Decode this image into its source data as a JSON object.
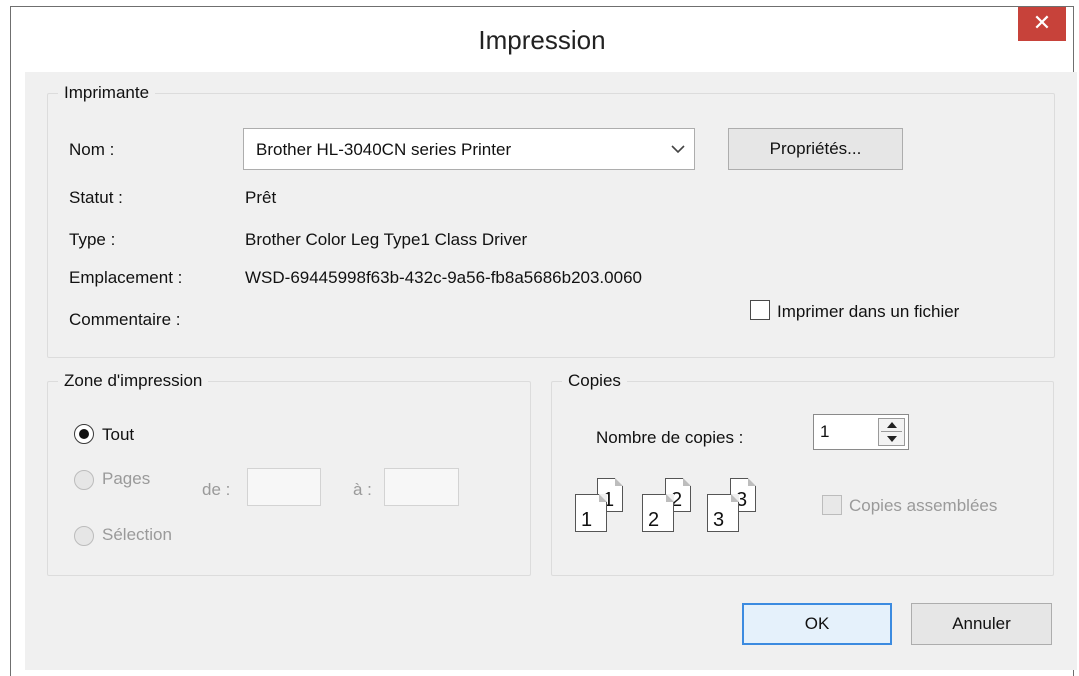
{
  "window": {
    "title": "Impression",
    "close_glyph": "✕"
  },
  "printer": {
    "legend": "Imprimante",
    "name_label": "Nom :",
    "name_value": "Brother HL-3040CN series Printer",
    "properties_button": "Propriétés...",
    "status_label": "Statut :",
    "status_value": "Prêt",
    "type_label": "Type :",
    "type_value": "Brother Color Leg Type1 Class Driver",
    "location_label": "Emplacement :",
    "location_value": "WSD-69445998f63b-432c-9a56-fb8a5686b203.0060",
    "comment_label": "Commentaire :",
    "print_to_file_label": "Imprimer dans un fichier"
  },
  "print_range": {
    "legend": "Zone d'impression",
    "all_label": "Tout",
    "pages_label": "Pages",
    "from_label": "de :",
    "to_label": "à :",
    "selection_label": "Sélection"
  },
  "copies": {
    "legend": "Copies",
    "count_label": "Nombre de copies :",
    "count_value": "1",
    "collate_label": "Copies assemblées",
    "page_numbers": [
      "1",
      "1",
      "2",
      "2",
      "3",
      "3"
    ]
  },
  "actions": {
    "ok": "OK",
    "cancel": "Annuler"
  },
  "colors": {
    "close_button": "#c7423a",
    "default_button_border": "#3c8be0"
  }
}
